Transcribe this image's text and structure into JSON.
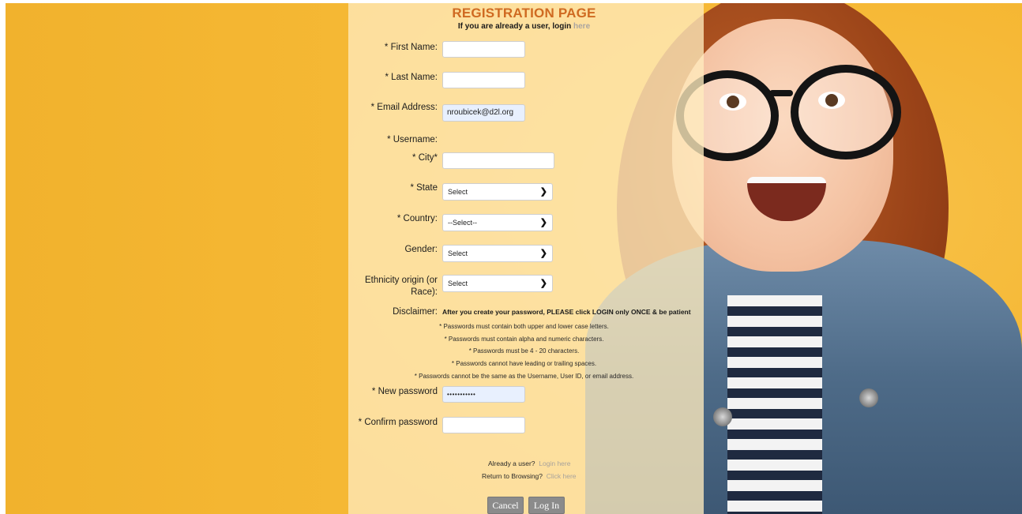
{
  "header": {
    "title": "REGISTRATION PAGE",
    "subtitle_prefix": "If you are already a user, login",
    "subtitle_link": "here"
  },
  "form": {
    "first_name": {
      "label": "* First Name:",
      "value": ""
    },
    "last_name": {
      "label": "* Last Name:",
      "value": ""
    },
    "email": {
      "label": "* Email Address:",
      "value": "nroubicek@d2l.org"
    },
    "username": {
      "label": "* Username:"
    },
    "city": {
      "label": "* City*",
      "value": ""
    },
    "state": {
      "label": "* State",
      "selected": "Select"
    },
    "country": {
      "label": "* Country:",
      "selected": "--Select--"
    },
    "gender": {
      "label": "Gender:",
      "selected": "Select"
    },
    "ethnicity": {
      "label_line1": "Ethnicity origin (or",
      "label_line2": "Race):",
      "selected": "Select"
    },
    "disclaimer": {
      "label": "Disclaimer:",
      "text": "After you create your password, PLEASE click LOGIN only ONCE & be patient"
    },
    "password_rules": [
      "* Passwords must contain both upper and lower case letters.",
      "* Passwords must contain alpha and numeric characters.",
      "* Passwords must be 4 - 20 characters.",
      "* Passwords cannot have leading or trailing spaces.",
      "* Passwords cannot be the same as the Username, User ID, or email address."
    ],
    "new_password": {
      "label": "* New password",
      "value": "•••••••••••"
    },
    "confirm_password": {
      "label": "* Confirm password",
      "value": ""
    }
  },
  "footer": {
    "already_user": "Already a user?",
    "login_here": "Login here",
    "return_browsing": "Return to Browsing?",
    "click_here": "Click here",
    "cancel_label": "Cancel",
    "login_label": "Log In"
  },
  "colors": {
    "background": "#f5b731",
    "title": "#cf6a21",
    "link": "#a8a39c",
    "button": "#8b8b8b"
  }
}
